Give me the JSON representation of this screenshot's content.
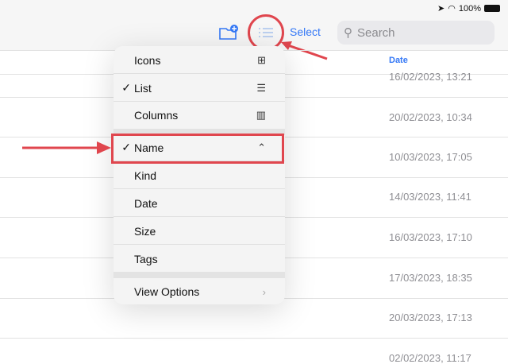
{
  "status": {
    "battery": "100%"
  },
  "toolbar": {
    "select_label": "Select",
    "search_placeholder": "Search"
  },
  "list": {
    "date_header": "Date",
    "dates": [
      "16/02/2023, 13:21",
      "20/02/2023, 10:34",
      "10/03/2023, 17:05",
      "14/03/2023, 11:41",
      "16/03/2023, 17:10",
      "17/03/2023, 18:35",
      "20/03/2023, 17:13",
      "02/02/2023, 11:17"
    ]
  },
  "menu": {
    "items": [
      {
        "label": "Icons",
        "check": "",
        "icon": "⊞"
      },
      {
        "label": "List",
        "check": "✓",
        "icon": "☰"
      },
      {
        "label": "Columns",
        "check": "",
        "icon": "▥"
      },
      {
        "label": "Name",
        "check": "✓",
        "icon": "⌃"
      },
      {
        "label": "Kind",
        "check": ""
      },
      {
        "label": "Date",
        "check": ""
      },
      {
        "label": "Size",
        "check": ""
      },
      {
        "label": "Tags",
        "check": ""
      }
    ],
    "view_options": "View Options",
    "chevron": "›"
  },
  "annotation_color": "#e0464e"
}
